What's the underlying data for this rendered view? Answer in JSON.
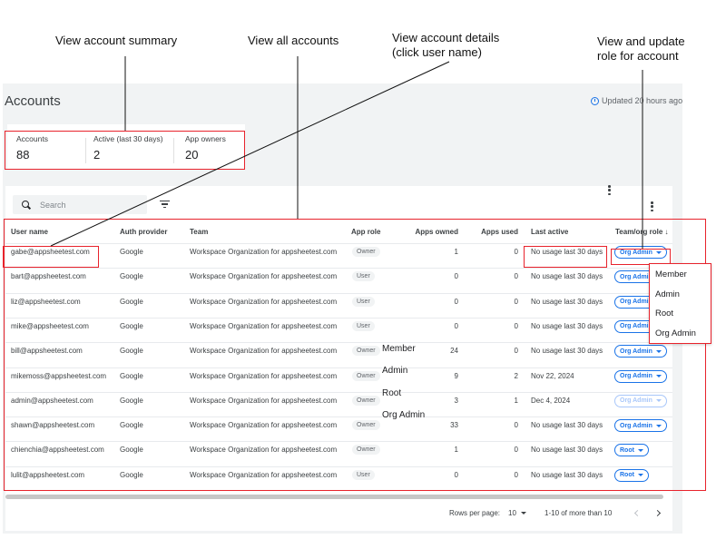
{
  "callouts": {
    "summary": "View account summary",
    "all_accounts": "View all accounts",
    "details": "View account details\n(click user name)",
    "role": "View and update\nrole for account"
  },
  "page": {
    "title": "Accounts",
    "updated": "Updated 20 hours ago"
  },
  "summary": [
    {
      "label": "Accounts",
      "value": "88"
    },
    {
      "label": "Active (last 30 days)",
      "value": "2"
    },
    {
      "label": "App owners",
      "value": "20"
    }
  ],
  "search": {
    "placeholder": "Search"
  },
  "columns": {
    "user_name": "User name",
    "auth_provider": "Auth provider",
    "team": "Team",
    "app_role": "App role",
    "apps_owned": "Apps owned",
    "apps_used": "Apps used",
    "last_active": "Last active",
    "team_role": "Team/org role"
  },
  "rows": [
    {
      "user": "gabe@appsheetest.com",
      "auth": "Google",
      "team": "Workspace Organization for appsheetest.com",
      "app_role": "Owner",
      "owned": "1",
      "used": "0",
      "last": "No usage last 30 days",
      "role": "Org Admin"
    },
    {
      "user": "bart@appsheetest.com",
      "auth": "Google",
      "team": "Workspace Organization for appsheetest.com",
      "app_role": "User",
      "owned": "0",
      "used": "0",
      "last": "No usage last 30 days",
      "role": "Org Admin"
    },
    {
      "user": "liz@appsheetest.com",
      "auth": "Google",
      "team": "Workspace Organization for appsheetest.com",
      "app_role": "User",
      "owned": "0",
      "used": "0",
      "last": "No usage last 30 days",
      "role": "Org Admin"
    },
    {
      "user": "mike@appsheetest.com",
      "auth": "Google",
      "team": "Workspace Organization for appsheetest.com",
      "app_role": "User",
      "owned": "0",
      "used": "0",
      "last": "No usage last 30 days",
      "role": "Org Admin"
    },
    {
      "user": "bill@appsheetest.com",
      "auth": "Google",
      "team": "Workspace Organization for appsheetest.com",
      "app_role": "Owner",
      "owned": "24",
      "used": "0",
      "last": "No usage last 30 days",
      "role": "Org Admin"
    },
    {
      "user": "mikemoss@appsheetest.com",
      "auth": "Google",
      "team": "Workspace Organization for appsheetest.com",
      "app_role": "Owner",
      "owned": "9",
      "used": "2",
      "last": "Nov 22, 2024",
      "role": "Org Admin"
    },
    {
      "user": "admin@appsheetest.com",
      "auth": "Google",
      "team": "Workspace Organization for appsheetest.com",
      "app_role": "Owner",
      "owned": "3",
      "used": "1",
      "last": "Dec 4, 2024",
      "role": "Org Admin"
    },
    {
      "user": "shawn@appsheetest.com",
      "auth": "Google",
      "team": "Workspace Organization for appsheetest.com",
      "app_role": "Owner",
      "owned": "33",
      "used": "0",
      "last": "No usage last 30 days",
      "role": "Org Admin"
    },
    {
      "user": "chienchia@appsheetest.com",
      "auth": "Google",
      "team": "Workspace Organization for appsheetest.com",
      "app_role": "Owner",
      "owned": "1",
      "used": "0",
      "last": "No usage last 30 days",
      "role": "Root"
    },
    {
      "user": "lulit@appsheetest.com",
      "auth": "Google",
      "team": "Workspace Organization for appsheetest.com",
      "app_role": "User",
      "owned": "0",
      "used": "0",
      "last": "No usage last 30 days",
      "role": "Root"
    }
  ],
  "role_menu": [
    "Member",
    "Admin",
    "Root",
    "Org Admin"
  ],
  "stray_menu": [
    "Member",
    "Admin",
    "Root",
    "Org Admin"
  ],
  "footer": {
    "rows_per_page_label": "Rows per page:",
    "rows_per_page": "10",
    "range": "1-10 of more than 10"
  },
  "colors": {
    "accent": "#1a73e8",
    "highlight": "#e8232c"
  }
}
